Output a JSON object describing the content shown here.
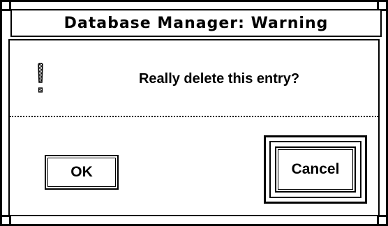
{
  "dialog": {
    "title": "Database Manager: Warning",
    "message": "Really delete this entry?",
    "icon": "exclamation-icon"
  },
  "buttons": {
    "ok_label": "OK",
    "cancel_label": "Cancel",
    "default": "Cancel"
  },
  "colors": {
    "foreground": "#000000",
    "background": "#ffffff"
  }
}
